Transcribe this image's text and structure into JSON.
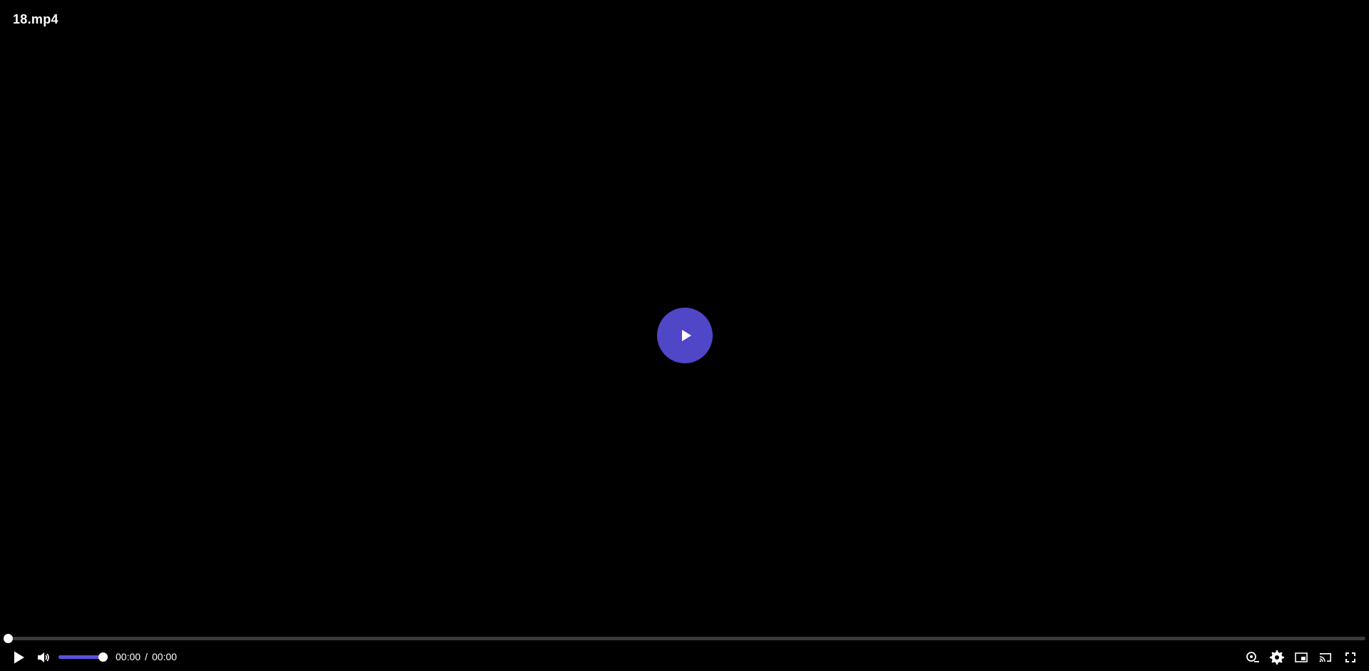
{
  "player": {
    "title": "18.mp4",
    "current_time": "00:00",
    "time_separator": "/",
    "duration": "00:00",
    "progress": 0.0,
    "volume": 1.0,
    "accent_color": "#4f46c8"
  },
  "icons": {
    "big_play": "play-icon",
    "play": "play-icon",
    "volume": "volume-icon",
    "speed": "playback-speed-icon",
    "settings": "gear-icon",
    "pip": "picture-in-picture-icon",
    "cast": "cast-icon",
    "fullscreen": "fullscreen-icon"
  }
}
